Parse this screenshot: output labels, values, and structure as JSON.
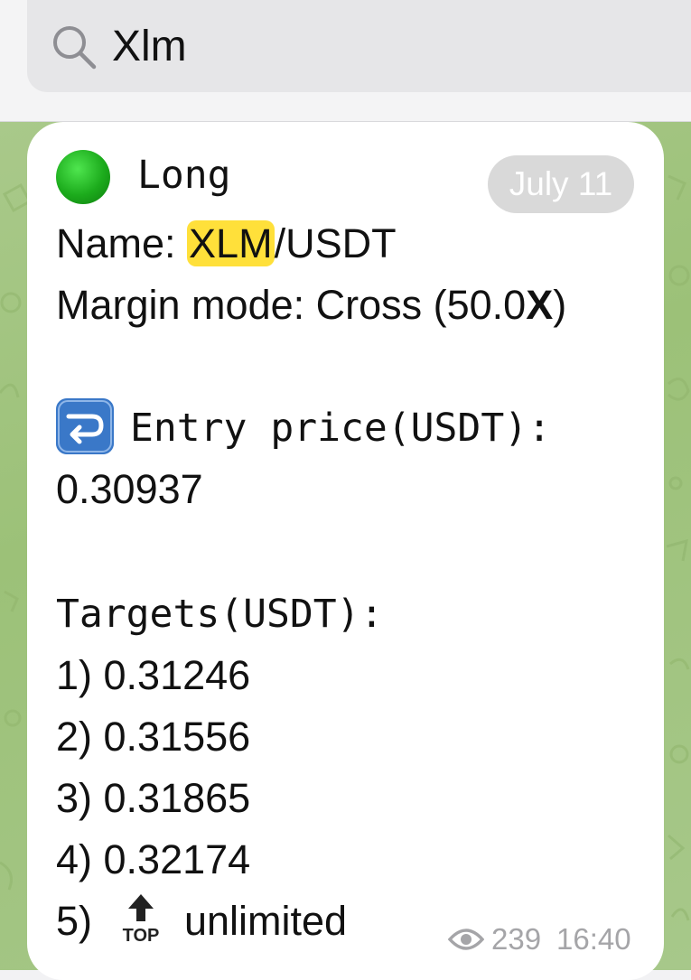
{
  "search": {
    "query": "Xlm"
  },
  "message": {
    "date": "July 11",
    "direction_label": "Long",
    "name_prefix": "Name: ",
    "name_highlight": "XLM",
    "name_suffix": "/USDT",
    "margin_line": "Margin mode: Cross (50.0",
    "margin_x": "X",
    "margin_close": ")",
    "entry_label": "Entry price(USDT):",
    "entry_value": "0.30937",
    "targets_label": "Targets(USDT):",
    "targets": [
      "1) 0.31246",
      "2) 0.31556",
      "3) 0.31865",
      "4) 0.32174"
    ],
    "target5_prefix": "5)",
    "target5_icon_text": "TOP",
    "target5_value": "unlimited",
    "views": "239",
    "time": "16:40"
  },
  "icons": {
    "search": "search-icon",
    "direction": "green-circle-icon",
    "entry": "right-arrow-curving-left-icon",
    "top": "top-arrow-icon",
    "views": "eye-icon"
  },
  "colors": {
    "highlight": "#ffe03a",
    "chat_background": "#a9c98a",
    "bubble": "#ffffff",
    "meta_text": "#a5a5a8"
  }
}
